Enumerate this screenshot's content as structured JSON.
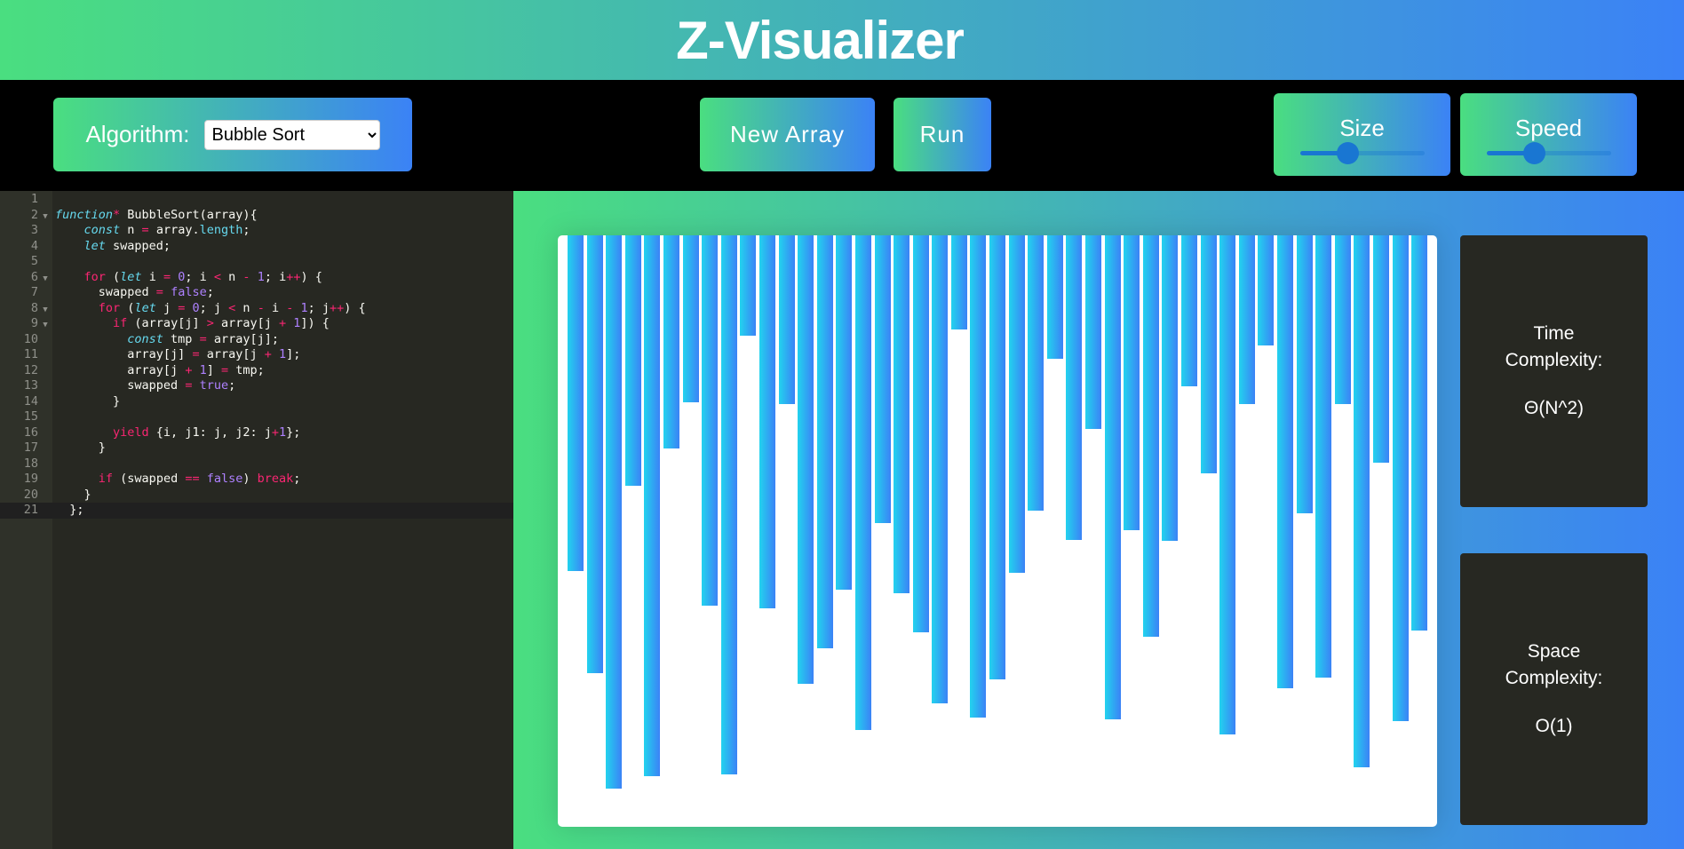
{
  "header": {
    "title": "Z-Visualizer"
  },
  "toolbar": {
    "algorithm_label": "Algorithm:",
    "algorithm_selected": "Bubble Sort",
    "new_array_label": "New Array",
    "run_label": "Run",
    "size": {
      "label": "Size",
      "value_percent": 38
    },
    "speed": {
      "label": "Speed",
      "value_percent": 38
    }
  },
  "editor": {
    "active_line": 21,
    "folds": [
      2,
      6,
      8,
      9
    ],
    "lines": [
      [],
      [
        [
          "function",
          "st"
        ],
        [
          "*",
          "kw"
        ],
        [
          " BubbleSort(array){",
          ""
        ]
      ],
      [
        [
          "    ",
          ""
        ],
        [
          "const",
          "st"
        ],
        [
          " n ",
          ""
        ],
        [
          "=",
          "kw"
        ],
        [
          " array.",
          ""
        ],
        [
          "length",
          "fn"
        ],
        [
          ";",
          ""
        ]
      ],
      [
        [
          "    ",
          ""
        ],
        [
          "let",
          "st"
        ],
        [
          " swapped;",
          ""
        ]
      ],
      [],
      [
        [
          "    ",
          ""
        ],
        [
          "for",
          "kw"
        ],
        [
          " (",
          ""
        ],
        [
          "let",
          "st"
        ],
        [
          " i ",
          ""
        ],
        [
          "=",
          "kw"
        ],
        [
          " ",
          ""
        ],
        [
          "0",
          "num"
        ],
        [
          "; i ",
          ""
        ],
        [
          "<",
          "kw"
        ],
        [
          " n ",
          ""
        ],
        [
          "-",
          "kw"
        ],
        [
          " ",
          ""
        ],
        [
          "1",
          "num"
        ],
        [
          "; i",
          ""
        ],
        [
          "++",
          "kw"
        ],
        [
          ") {",
          ""
        ]
      ],
      [
        [
          "      swapped ",
          ""
        ],
        [
          "=",
          "kw"
        ],
        [
          " ",
          ""
        ],
        [
          "false",
          "num"
        ],
        [
          ";",
          ""
        ]
      ],
      [
        [
          "      ",
          ""
        ],
        [
          "for",
          "kw"
        ],
        [
          " (",
          ""
        ],
        [
          "let",
          "st"
        ],
        [
          " j ",
          ""
        ],
        [
          "=",
          "kw"
        ],
        [
          " ",
          ""
        ],
        [
          "0",
          "num"
        ],
        [
          "; j ",
          ""
        ],
        [
          "<",
          "kw"
        ],
        [
          " n ",
          ""
        ],
        [
          "-",
          "kw"
        ],
        [
          " i ",
          ""
        ],
        [
          "-",
          "kw"
        ],
        [
          " ",
          ""
        ],
        [
          "1",
          "num"
        ],
        [
          "; j",
          ""
        ],
        [
          "++",
          "kw"
        ],
        [
          ") {",
          ""
        ]
      ],
      [
        [
          "        ",
          ""
        ],
        [
          "if",
          "kw"
        ],
        [
          " (array[j] ",
          ""
        ],
        [
          ">",
          "kw"
        ],
        [
          " array[j ",
          ""
        ],
        [
          "+",
          "kw"
        ],
        [
          " ",
          ""
        ],
        [
          "1",
          "num"
        ],
        [
          "]) {",
          ""
        ]
      ],
      [
        [
          "          ",
          ""
        ],
        [
          "const",
          "st"
        ],
        [
          " tmp ",
          ""
        ],
        [
          "=",
          "kw"
        ],
        [
          " array[j];",
          ""
        ]
      ],
      [
        [
          "          array[j] ",
          ""
        ],
        [
          "=",
          "kw"
        ],
        [
          " array[j ",
          ""
        ],
        [
          "+",
          "kw"
        ],
        [
          " ",
          ""
        ],
        [
          "1",
          "num"
        ],
        [
          "];",
          ""
        ]
      ],
      [
        [
          "          array[j ",
          ""
        ],
        [
          "+",
          "kw"
        ],
        [
          " ",
          ""
        ],
        [
          "1",
          "num"
        ],
        [
          "] ",
          ""
        ],
        [
          "=",
          "kw"
        ],
        [
          " tmp;",
          ""
        ]
      ],
      [
        [
          "          swapped ",
          ""
        ],
        [
          "=",
          "kw"
        ],
        [
          " ",
          ""
        ],
        [
          "true",
          "num"
        ],
        [
          ";",
          ""
        ]
      ],
      [
        [
          "        }",
          ""
        ]
      ],
      [],
      [
        [
          "        ",
          ""
        ],
        [
          "yield",
          "kw"
        ],
        [
          " {i, j1: j, j2: j",
          ""
        ],
        [
          "+",
          "kw"
        ],
        [
          "1",
          "num"
        ],
        [
          "};",
          ""
        ]
      ],
      [
        [
          "      }",
          ""
        ]
      ],
      [],
      [
        [
          "      ",
          ""
        ],
        [
          "if",
          "kw"
        ],
        [
          " (swapped ",
          ""
        ],
        [
          "==",
          "kw"
        ],
        [
          " ",
          ""
        ],
        [
          "false",
          "num"
        ],
        [
          ") ",
          ""
        ],
        [
          "break",
          "kw"
        ],
        [
          ";",
          ""
        ]
      ],
      [
        [
          "    }",
          ""
        ]
      ],
      [
        [
          "  };",
          ""
        ]
      ]
    ]
  },
  "visualizer": {
    "bar_color_start": "#22d3ee",
    "bar_color_end": "#3b82f6",
    "array": [
      378,
      493,
      623,
      282,
      609,
      240,
      188,
      417,
      607,
      113,
      420,
      190,
      505,
      465,
      399,
      557,
      324,
      403,
      447,
      527,
      106,
      543,
      500,
      380,
      310,
      139,
      343,
      218,
      545,
      332,
      452,
      344,
      170,
      268,
      562,
      190,
      124,
      510,
      313,
      498,
      190,
      599,
      256,
      547,
      445
    ]
  },
  "complexity": {
    "time": {
      "label": "Time Complexity:",
      "value": "Θ(N^2)"
    },
    "space": {
      "label": "Space Complexity:",
      "value": "O(1)"
    }
  },
  "colors": {
    "gradient_start": "#4ade80",
    "gradient_end": "#3b82f6",
    "editor_bg": "#272822",
    "slider": "#1976d2"
  }
}
